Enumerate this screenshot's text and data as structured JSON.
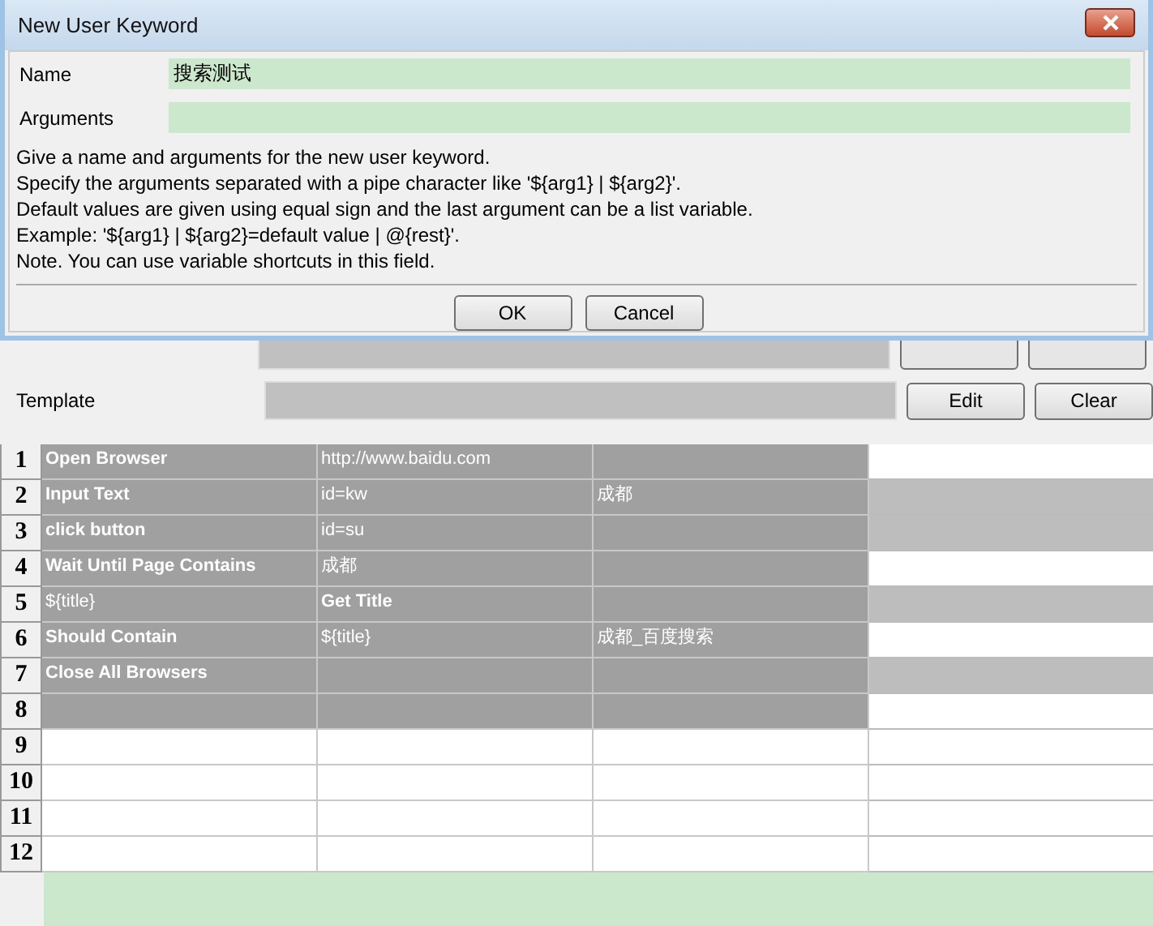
{
  "dialog": {
    "title": "New User Keyword",
    "fields": [
      {
        "label": "Name",
        "value": "搜索测试"
      },
      {
        "label": "Arguments"
      }
    ],
    "help": [
      "Give a name and arguments for the new user keyword.",
      "Specify the arguments separated with a pipe character like '${arg1} | ${arg2}'.",
      "Default values are given using equal sign and the last argument can be a list variable.",
      "Example: '${arg1} | ${arg2}=default value | @{rest}'.",
      "Note. You can use variable shortcuts in this field."
    ],
    "buttons": [
      "OK",
      "Cancel"
    ]
  },
  "settings": {
    "template_label": "Template",
    "buttons": [
      "Edit",
      "Clear"
    ]
  },
  "grid": {
    "rows": [
      {
        "number": "1",
        "filled": true,
        "tail_shaded": false,
        "cells": [
          {
            "text": "Open Browser",
            "bold": true
          },
          {
            "text": "http://www.baidu.com",
            "bold": false
          },
          null
        ]
      },
      {
        "number": "2",
        "filled": true,
        "tail_shaded": true,
        "cells": [
          {
            "text": "Input Text",
            "bold": true
          },
          {
            "text": "id=kw",
            "bold": false
          },
          {
            "text": "成都",
            "bold": false
          }
        ]
      },
      {
        "number": "3",
        "filled": true,
        "tail_shaded": true,
        "cells": [
          {
            "text": "click button",
            "bold": true
          },
          {
            "text": "id=su",
            "bold": false
          },
          null
        ]
      },
      {
        "number": "4",
        "filled": true,
        "tail_shaded": false,
        "cells": [
          {
            "text": "Wait Until Page Contains",
            "bold": true
          },
          {
            "text": "成都",
            "bold": false
          },
          null
        ]
      },
      {
        "number": "5",
        "filled": true,
        "tail_shaded": true,
        "cells": [
          {
            "text": "${title}",
            "bold": false
          },
          {
            "text": "Get Title",
            "bold": true
          },
          null
        ]
      },
      {
        "number": "6",
        "filled": true,
        "tail_shaded": false,
        "cells": [
          {
            "text": "Should Contain",
            "bold": true
          },
          {
            "text": "${title}",
            "bold": false
          },
          {
            "text": "成都_百度搜索",
            "bold": false
          }
        ]
      },
      {
        "number": "7",
        "filled": true,
        "tail_shaded": true,
        "cells": [
          {
            "text": "Close All Browsers",
            "bold": true
          },
          null,
          null
        ]
      },
      {
        "number": "8",
        "filled": true,
        "tail_shaded": false,
        "cells": [
          null,
          null,
          null
        ]
      },
      {
        "number": "9",
        "filled": false,
        "tail_shaded": false,
        "cells": [
          null,
          null,
          null
        ]
      },
      {
        "number": "10",
        "filled": false,
        "tail_shaded": false,
        "cells": [
          null,
          null,
          null
        ]
      },
      {
        "number": "11",
        "filled": false,
        "tail_shaded": false,
        "cells": [
          null,
          null,
          null
        ]
      },
      {
        "number": "12",
        "filled": false,
        "tail_shaded": false,
        "cells": [
          null,
          null,
          null
        ]
      }
    ]
  }
}
